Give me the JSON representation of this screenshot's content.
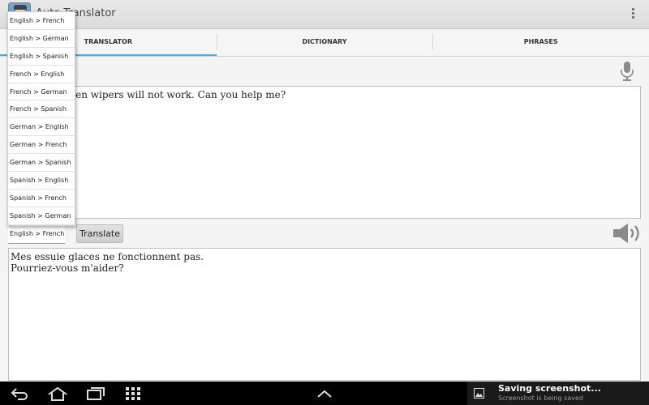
{
  "app": {
    "title": "Auto Translator"
  },
  "tabs": [
    {
      "label": "TRANSLATOR",
      "active": true
    },
    {
      "label": "DICTIONARY",
      "active": false
    },
    {
      "label": "PHRASES",
      "active": false
    }
  ],
  "source": {
    "text": "My windscreen wipers will not work. Can you help me?"
  },
  "language_select": {
    "value": "English > French"
  },
  "translate_button": {
    "label": "Translate"
  },
  "output": {
    "text": "Mes essuie glaces ne fonctionnent pas.\nPourriez-vous m'aider?"
  },
  "dropdown": {
    "options": [
      "English > French",
      "English > German",
      "English > Spanish",
      "French > English",
      "French > German",
      "French > Spanish",
      "German > English",
      "German > French",
      "German > Spanish",
      "Spanish > English",
      "Spanish > French",
      "Spanish > German"
    ]
  },
  "notification": {
    "title": "Saving screenshot...",
    "subtitle": "Screenshot is being saved"
  },
  "icons": {
    "mic": "microphone-icon",
    "speaker": "speaker-icon",
    "overflow": "overflow-menu-icon",
    "back": "back-icon",
    "home": "home-icon",
    "recents": "recent-apps-icon",
    "apps": "apps-grid-icon",
    "up": "chevron-up-icon",
    "picture": "picture-icon"
  },
  "colors": {
    "tab_indicator": "#33b5e5"
  }
}
